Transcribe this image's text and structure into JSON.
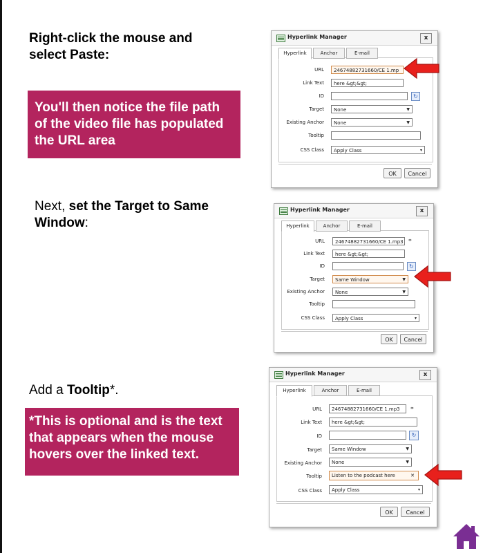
{
  "step1": {
    "heading_line1": "Right-click the mouse and",
    "heading_line2": "select Paste:",
    "callout_line1": "You'll then notice the file path",
    "callout_line2": "of the video file has populated",
    "callout_line3": "the URL area"
  },
  "step2": {
    "prefix": "Next, ",
    "bold1": "set the Target to Same",
    "bold2": "Window",
    "suffix": ":"
  },
  "step3": {
    "prefix": "Add a ",
    "bold": "Tooltip",
    "suffix": "*.",
    "callout_line1": "*This is optional and is the text",
    "callout_line2": "that appears when the mouse",
    "callout_line3": "hovers over the linked text."
  },
  "dialog": {
    "title": "Hyperlink Manager",
    "close": "x",
    "tabs": [
      "Hyperlink",
      "Anchor",
      "E-mail"
    ],
    "labels": {
      "url": "URL",
      "link_text": "Link Text",
      "id": "ID",
      "target": "Target",
      "existing_anchor": "Existing Anchor",
      "tooltip": "Tooltip",
      "css_class": "CSS Class"
    },
    "ok": "OK",
    "cancel": "Cancel"
  },
  "dialog1": {
    "url": "24674882731660/CE 1.mp",
    "link_text": "here &gt;&gt;",
    "target": "None",
    "existing_anchor": "None",
    "tooltip": "",
    "css_class": "Apply Class"
  },
  "dialog2": {
    "url": "24674882731660/CE 1.mp3",
    "link_text": "here &gt;&gt;",
    "target": "Same Window",
    "existing_anchor": "None",
    "tooltip": "",
    "css_class": "Apply Class"
  },
  "dialog3": {
    "url": "24674882731660/CE 1.mp3",
    "link_text": "here &gt;&gt;",
    "target": "Same Window",
    "existing_anchor": "None",
    "tooltip": "Listen to the podcast here",
    "css_class": "Apply Class"
  },
  "icons": {
    "arrow": "red-arrow-icon",
    "home": "home-icon",
    "refresh": "refresh-icon",
    "link": "link-icon"
  },
  "colors": {
    "callout": "#b3245e",
    "arrow": "#e8201c",
    "home": "#7a2e93"
  }
}
